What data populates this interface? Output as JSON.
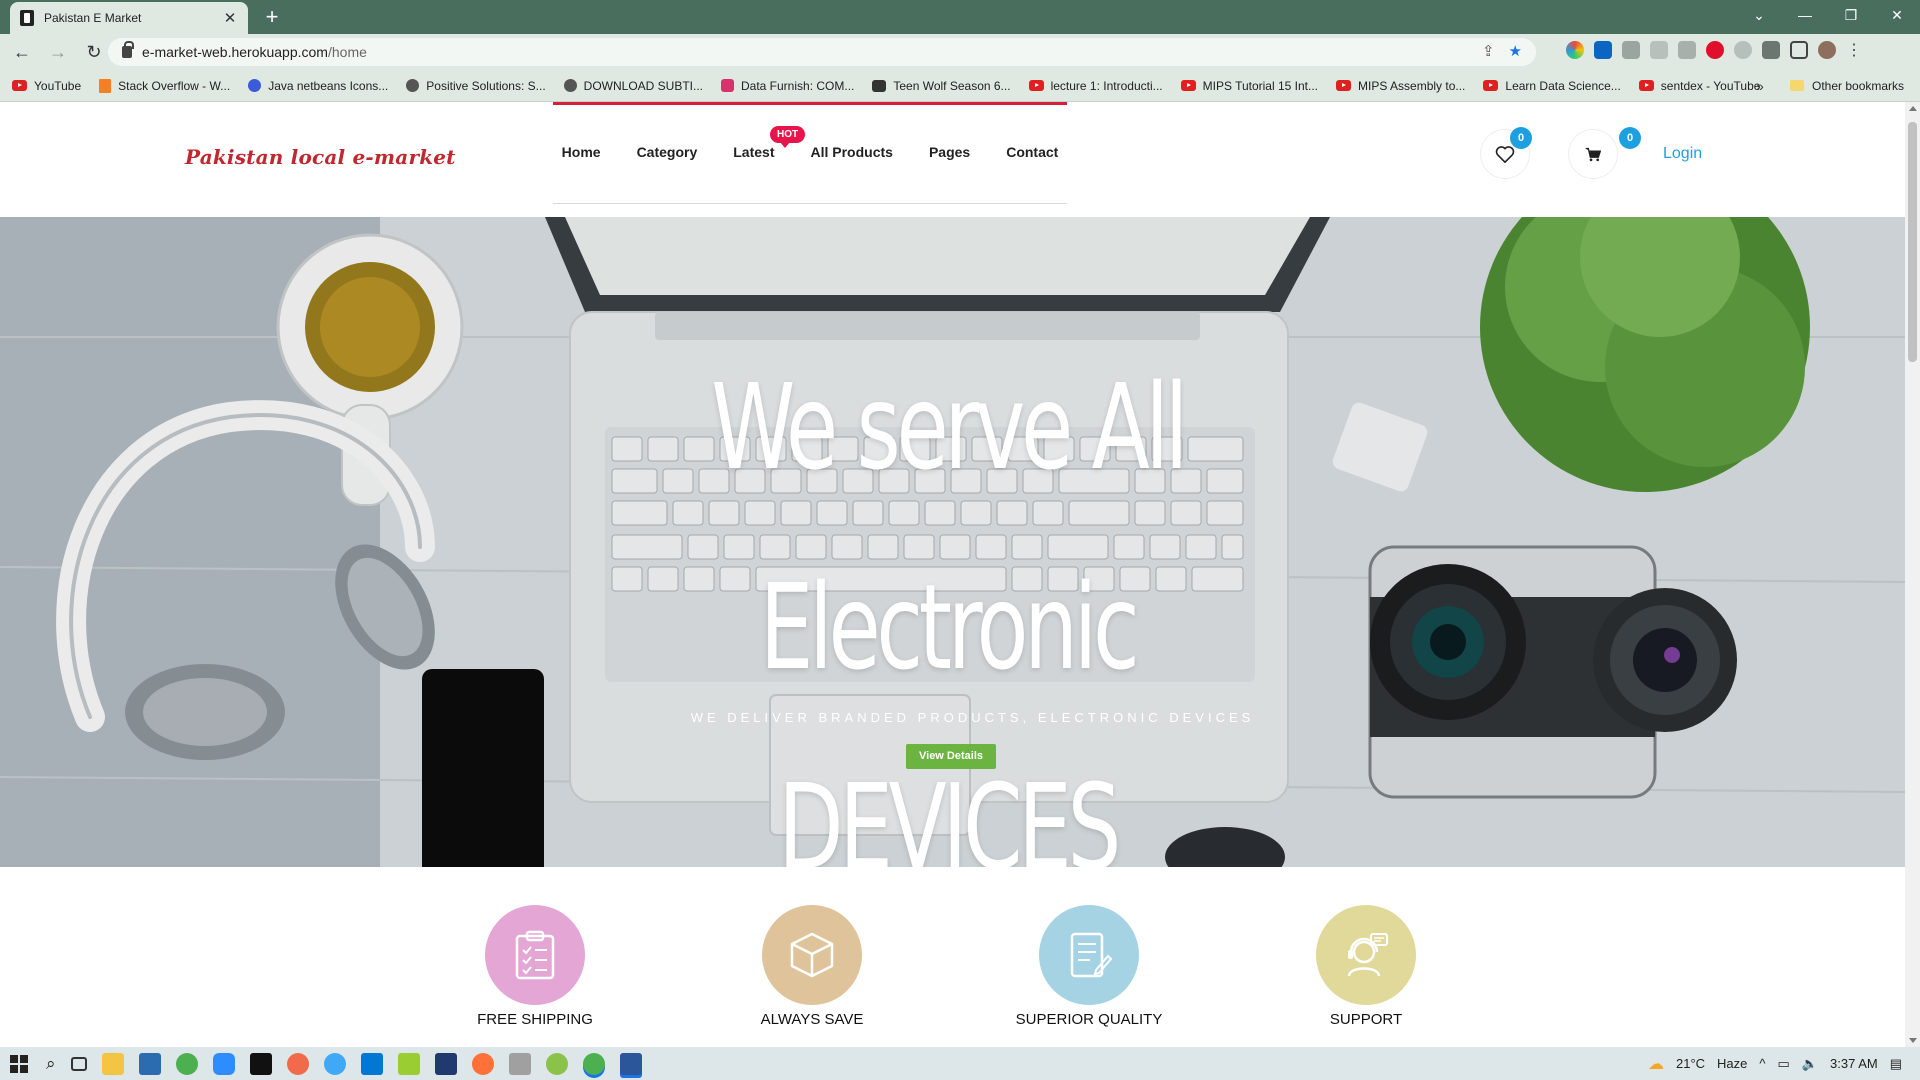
{
  "browser": {
    "tab_title": "Pakistan E Market",
    "url_host": "e-market-web.herokuapp.com",
    "url_path": "/home",
    "bookmarks": [
      {
        "label": "YouTube",
        "icon": "youtube-icon"
      },
      {
        "label": "Stack Overflow - W...",
        "icon": "stackoverflow-icon"
      },
      {
        "label": "Java netbeans Icons...",
        "icon": "star-badge-icon"
      },
      {
        "label": "Positive Solutions: S...",
        "icon": "globe-icon"
      },
      {
        "label": "DOWNLOAD SUBTI...",
        "icon": "globe-icon"
      },
      {
        "label": "Data Furnish: COM...",
        "icon": "instagram-icon"
      },
      {
        "label": "Teen Wolf Season 6...",
        "icon": "tv-icon"
      },
      {
        "label": "lecture 1: Introducti...",
        "icon": "youtube-icon"
      },
      {
        "label": "MIPS Tutorial 15 Int...",
        "icon": "youtube-icon"
      },
      {
        "label": "MIPS Assembly to...",
        "icon": "youtube-icon"
      },
      {
        "label": "Learn Data Science...",
        "icon": "youtube-icon"
      },
      {
        "label": "sentdex - YouTube",
        "icon": "youtube-icon"
      }
    ],
    "other_bookmarks": "Other bookmarks"
  },
  "site": {
    "logo": "Pakistan local e-market",
    "nav": [
      "Home",
      "Category",
      "Latest",
      "All Products",
      "Pages",
      "Contact"
    ],
    "hot_badge": "HOT",
    "wishlist_count": "0",
    "cart_count": "0",
    "login": "Login"
  },
  "hero": {
    "title_line1": "We serve All Electronic",
    "title_line2": "devices",
    "subtitle": "WE DELIVER BRANDED PRODUCTS, ELECTRONIC DEVICES",
    "button": "View Details"
  },
  "features": [
    {
      "label": "FREE SHIPPING",
      "color": "#e3a6d5",
      "icon": "clipboard-icon"
    },
    {
      "label": "ALWAYS SAVE",
      "color": "#dfc39a",
      "icon": "box-icon"
    },
    {
      "label": "SUPERIOR QUALITY",
      "color": "#a6d3e3",
      "icon": "document-icon"
    },
    {
      "label": "SUPPORT",
      "color": "#e0d99a",
      "icon": "support-agent-icon"
    }
  ],
  "taskbar": {
    "weather": "21°C",
    "condition": "Haze",
    "time": "3:37 AM"
  },
  "colors": {
    "accent_red": "#d71f37",
    "badge_blue": "#1e9fe0",
    "button_green": "#6bb441"
  }
}
